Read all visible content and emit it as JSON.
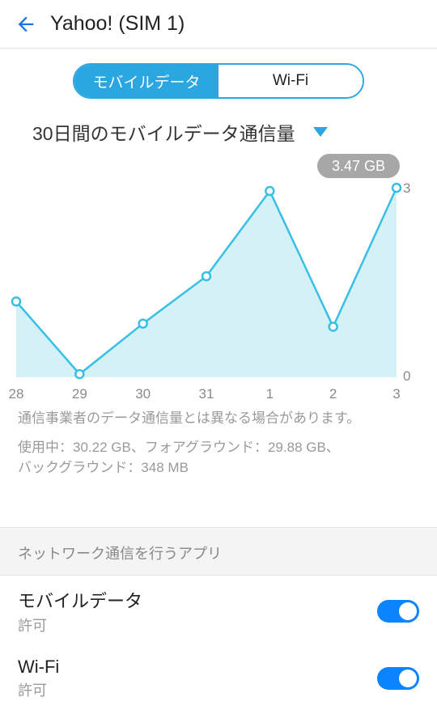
{
  "header": {
    "title": "Yahoo! (SIM 1)"
  },
  "tabs": {
    "mobile": "モバイルデータ",
    "wifi": "Wi-Fi"
  },
  "subtitle": "30日間のモバイルデータ通信量",
  "chart_data": {
    "type": "line",
    "categories": [
      "28",
      "29",
      "30",
      "31",
      "1",
      "2",
      "3"
    ],
    "values": [
      1.2,
      0.05,
      0.85,
      1.6,
      2.95,
      0.8,
      3.0
    ],
    "ylim": [
      0,
      3
    ],
    "y_ticks": [
      "0",
      "3"
    ],
    "badge": "3.47 GB"
  },
  "note": "通信事業者のデータ通信量とは異なる場合があります。",
  "usage_line1": "使用中：30.22 GB、フォアグラウンド：29.88 GB、",
  "usage_line2": "バックグラウンド：348 MB",
  "section_header": "ネットワーク通信を行うアプリ",
  "prefs": {
    "mobile": {
      "title": "モバイルデータ",
      "sub": "許可"
    },
    "wifi": {
      "title": "Wi-Fi",
      "sub": "許可"
    }
  }
}
